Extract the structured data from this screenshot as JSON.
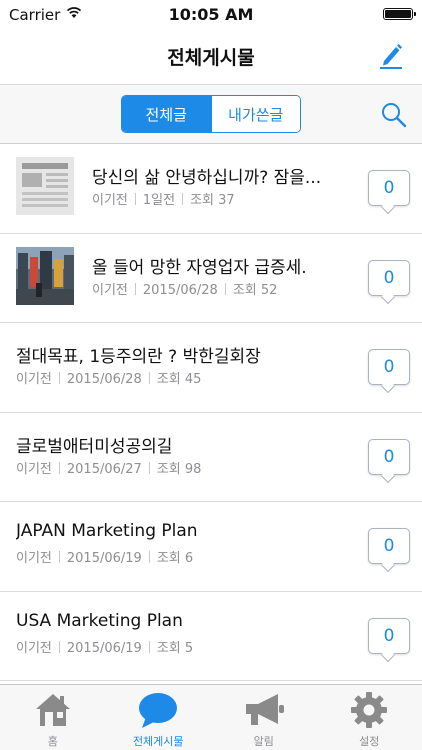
{
  "status_bar": {
    "carrier": "Carrier",
    "time": "10:05 AM"
  },
  "nav": {
    "title": "전체게시물"
  },
  "segment": {
    "all_label": "전체글",
    "mine_label": "내가쓴글",
    "selected": "전체글"
  },
  "posts": [
    {
      "title": "당신의 삶 안녕하십니까?   잠을...",
      "author": "이기전",
      "date": "1일전",
      "views": "조회 37",
      "comments": "0",
      "has_thumb": true
    },
    {
      "title": "올 들어 망한 자영업자 급증세.",
      "author": "이기전",
      "date": "2015/06/28",
      "views": "조회 52",
      "comments": "0",
      "has_thumb": true
    },
    {
      "title": "절대목표, 1등주의란 ? 박한길회장",
      "author": "이기전",
      "date": "2015/06/28",
      "views": "조회 45",
      "comments": "0",
      "has_thumb": false
    },
    {
      "title": "글로벌애터미성공의길",
      "author": "이기전",
      "date": "2015/06/27",
      "views": "조회 98",
      "comments": "0",
      "has_thumb": false
    },
    {
      "title": "JAPAN Marketing Plan",
      "author": "이기전",
      "date": "2015/06/19",
      "views": "조회 6",
      "comments": "0",
      "has_thumb": false
    },
    {
      "title": "USA Marketing Plan",
      "author": "이기전",
      "date": "2015/06/19",
      "views": "조회 5",
      "comments": "0",
      "has_thumb": false
    }
  ],
  "tabbar": {
    "home": "홈",
    "posts": "전체게시물",
    "alerts": "알림",
    "settings": "설정",
    "active": "전체게시물"
  },
  "colors": {
    "accent": "#1e8ae8",
    "icon_gray": "#8a8a8a",
    "meta_gray": "#8e8e93"
  }
}
